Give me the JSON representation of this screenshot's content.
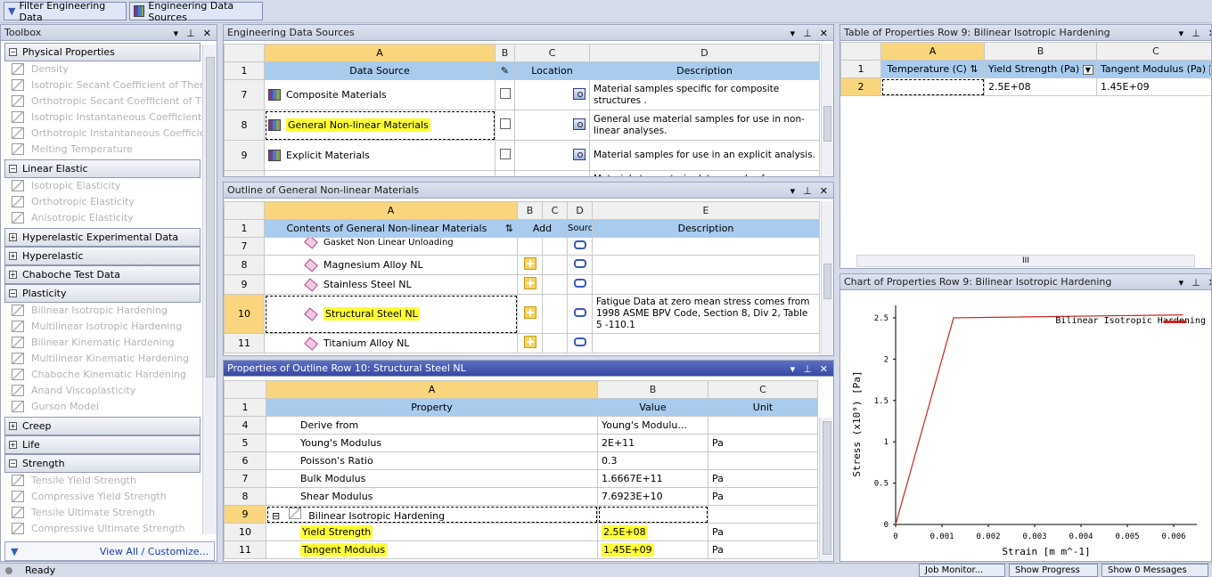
{
  "toolbar": {
    "filter_label": "Filter Engineering Data",
    "sources_label": "Engineering Data Sources"
  },
  "toolbox": {
    "title": "Toolbox",
    "groups": [
      {
        "label": "Physical Properties",
        "expanded": true,
        "items": [
          "Density",
          "Isotropic Secant Coefficient of Therma",
          "Orthotropic Secant Coefficient of Ther",
          "Isotropic Instantaneous Coefficient o",
          "Orthotropic Instantaneous Coefficien",
          "Melting Temperature"
        ]
      },
      {
        "label": "Linear Elastic",
        "expanded": true,
        "items": [
          "Isotropic Elasticity",
          "Orthotropic Elasticity",
          "Anisotropic Elasticity"
        ]
      },
      {
        "label": "Hyperelastic Experimental Data",
        "expanded": false,
        "items": []
      },
      {
        "label": "Hyperelastic",
        "expanded": false,
        "items": []
      },
      {
        "label": "Chaboche Test Data",
        "expanded": false,
        "items": []
      },
      {
        "label": "Plasticity",
        "expanded": true,
        "items": [
          "Bilinear Isotropic Hardening",
          "Multilinear Isotropic Hardening",
          "Bilinear Kinematic Hardening",
          "Multilinear Kinematic Hardening",
          "Chaboche Kinematic Hardening",
          "Anand Viscoplasticity",
          "Gurson Model"
        ]
      },
      {
        "label": "Creep",
        "expanded": false,
        "items": []
      },
      {
        "label": "Life",
        "expanded": false,
        "items": []
      },
      {
        "label": "Strength",
        "expanded": true,
        "items": [
          "Tensile Yield Strength",
          "Compressive Yield Strength",
          "Tensile Ultimate Strength",
          "Compressive Ultimate Strength"
        ]
      }
    ],
    "view_all": "View All / Customize..."
  },
  "sources": {
    "title": "Engineering Data Sources",
    "cols": [
      "A",
      "B",
      "C",
      "D"
    ],
    "hdr": {
      "rn": "1",
      "a": "Data Source",
      "c": "Location",
      "d": "Description"
    },
    "rows": [
      {
        "n": "7",
        "name": "Composite Materials",
        "desc": "Material samples specific for composite structures ."
      },
      {
        "n": "8",
        "name": "General Non-linear Materials",
        "desc": "General use material samples for use in non-linear analyses."
      },
      {
        "n": "9",
        "name": "Explicit Materials",
        "desc": "Material samples for use in an explicit analysis."
      },
      {
        "n": "",
        "name": "",
        "desc": "Material stress-strain data samples for curve"
      }
    ]
  },
  "outline": {
    "title": "Outline of General Non-linear Materials",
    "cols": [
      "A",
      "B",
      "C",
      "D",
      "E"
    ],
    "hdr": {
      "rn": "1",
      "a": "Contents of General Non-linear Materials",
      "b": "Add",
      "d": "Source",
      "e": "Description"
    },
    "rows": [
      {
        "n": "7",
        "name": "Gasket Non Linear Unloading",
        "desc": ""
      },
      {
        "n": "8",
        "name": "Magnesium Alloy NL",
        "desc": ""
      },
      {
        "n": "9",
        "name": "Stainless Steel NL",
        "desc": ""
      },
      {
        "n": "10",
        "name": "Structural Steel NL",
        "desc": "Fatigue Data at zero mean stress comes from 1998 ASME BPV Code, Section 8, Div 2, Table 5 -110.1"
      },
      {
        "n": "11",
        "name": "Titanium Alloy NL",
        "desc": ""
      }
    ]
  },
  "props": {
    "title": "Properties of Outline Row 10: Structural Steel NL",
    "cols": [
      "A",
      "B",
      "C"
    ],
    "hdr": {
      "rn": "1",
      "a": "Property",
      "b": "Value",
      "c": "Unit"
    },
    "rows": [
      {
        "n": "4",
        "prop": "Derive from",
        "val": "Young's Modulu...",
        "unit": ""
      },
      {
        "n": "5",
        "prop": "Young's Modulus",
        "val": "2E+11",
        "unit": "Pa"
      },
      {
        "n": "6",
        "prop": "Poisson's Ratio",
        "val": "0.3",
        "unit": ""
      },
      {
        "n": "7",
        "prop": "Bulk Modulus",
        "val": "1.6667E+11",
        "unit": "Pa"
      },
      {
        "n": "8",
        "prop": "Shear Modulus",
        "val": "7.6923E+10",
        "unit": "Pa"
      },
      {
        "n": "9",
        "prop": "Bilinear Isotropic Hardening",
        "val": "",
        "unit": ""
      },
      {
        "n": "10",
        "prop": "Yield Strength",
        "val": "2.5E+08",
        "unit": "Pa"
      },
      {
        "n": "11",
        "prop": "Tangent Modulus",
        "val": "1.45E+09",
        "unit": "Pa"
      }
    ]
  },
  "table_props": {
    "title": "Table of Properties Row 9: Bilinear Isotropic Hardening",
    "cols": [
      "A",
      "B",
      "C"
    ],
    "hdr": {
      "rn": "1",
      "a": "Temperature (C)",
      "b": "Yield Strength (Pa)",
      "c": "Tangent Modulus (Pa)"
    },
    "row": {
      "n": "2",
      "a": "",
      "b": "2.5E+08",
      "c": "1.45E+09"
    },
    "scroll_mark": "III"
  },
  "chart": {
    "title": "Chart of Properties Row 9: Bilinear Isotropic Hardening"
  },
  "chart_data": {
    "type": "line",
    "title": "",
    "xlabel": "Strain  [m m^-1]",
    "ylabel": "Stress  (x10⁹)  [Pa]",
    "xlim": [
      0,
      0.0065
    ],
    "ylim": [
      0,
      2.65
    ],
    "xticks": [
      "0",
      "0.001",
      "0.002",
      "0.003",
      "0.004",
      "0.005",
      "0.006"
    ],
    "yticks": [
      "0",
      "0.5",
      "1",
      "1.5",
      "2",
      "2.5"
    ],
    "series": [
      {
        "name": "Bilinear Isotropic Hardening",
        "color": "#cc2222",
        "x": [
          0,
          0.00125,
          0.0062
        ],
        "y": [
          0,
          2.5,
          2.5357
        ]
      }
    ],
    "legend": "top-right"
  },
  "status": {
    "text": "Ready",
    "job_monitor": "Job Monitor...",
    "show_progress": "Show Progress",
    "show_messages": "Show 0 Messages"
  },
  "colors": {
    "highlight": "#ffff33",
    "selected": "#f9d57d",
    "header_blue": "#a8cbee"
  }
}
